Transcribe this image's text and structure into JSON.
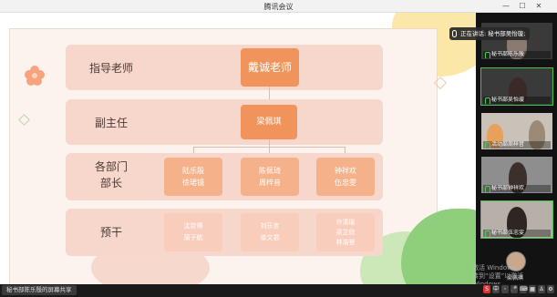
{
  "window": {
    "title": "腾讯会议",
    "controls": [
      "—",
      "☐",
      "✕"
    ]
  },
  "org_chart": {
    "rows": [
      {
        "label": "指导老师",
        "members": [
          [
            "戴诚老师"
          ]
        ]
      },
      {
        "label": "副主任",
        "members": [
          [
            "梁佩琪"
          ]
        ]
      },
      {
        "label_lines": [
          "各部门",
          "部长"
        ],
        "members": [
          [
            "陆乐殷",
            "徐珺镜"
          ],
          [
            "陈佩琦",
            "周梓音"
          ],
          [
            "钟祥欢",
            "伍忠雯"
          ]
        ]
      },
      {
        "label": "预干",
        "members": [
          [
            "沈钦博",
            "蒲子航"
          ],
          [
            "刘乐言",
            "徐文君"
          ],
          [
            "许清瑜",
            "梁芷欣",
            "林浩誉"
          ]
        ]
      }
    ]
  },
  "share_tag": "秘书部陈乐殷的屏幕共享",
  "speaking": "正在讲话: 秘书部吴怡璇;",
  "participants": [
    {
      "name": "秘书部陈乐殷",
      "color": "#6a5f58"
    },
    {
      "name": "秘书部吴怡璇",
      "color": "#4b4b4b"
    },
    {
      "name": "活动部周梓音",
      "color": "#7a6a55"
    },
    {
      "name": "秘书部钟祥欢",
      "color": "#5a5a5a"
    },
    {
      "name": "秘书部伍忠雯",
      "color": "#6d6d6d"
    }
  ],
  "self": {
    "name": "梁佩琪"
  },
  "watermark": {
    "line1": "激活 Windows",
    "line2": "转到“设置”以激活 Windows。"
  },
  "tray_icons": [
    "S",
    "中",
    "◦",
    "🎤",
    "⌨",
    "▦",
    "♙",
    "⚙"
  ],
  "colors": {
    "accent_strong": "#f0945c",
    "accent_mid": "#f4b18a",
    "accent_light": "#f8cdbb",
    "band": "#f7d6cb",
    "speaking_green": "#47c14b"
  }
}
